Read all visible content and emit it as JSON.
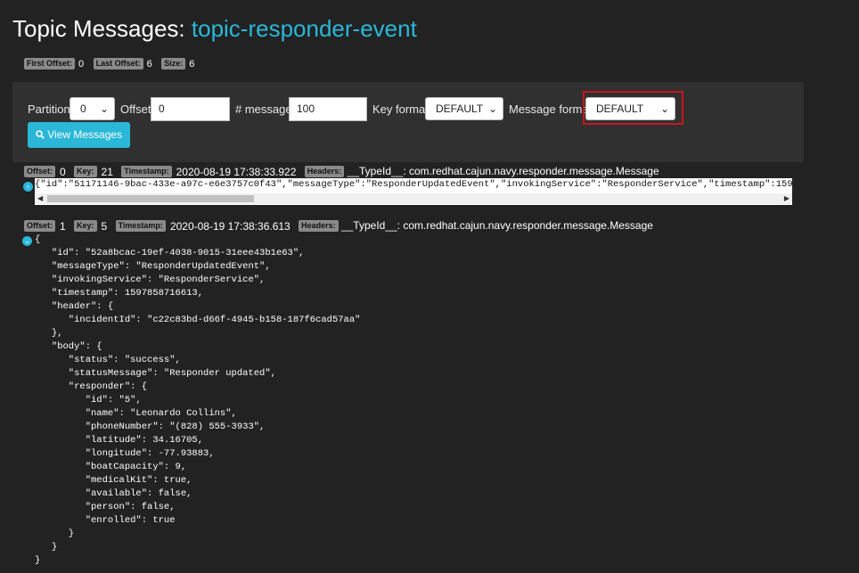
{
  "page": {
    "title_prefix": "Topic Messages:",
    "topic_name": "topic-responder-event",
    "accent_color": "#2ab7d8",
    "highlight_color": "#c8161d"
  },
  "meta": {
    "first_offset_label": "First Offset:",
    "first_offset": "0",
    "last_offset_label": "Last Offset:",
    "last_offset": "6",
    "size_label": "Size:",
    "size": "6"
  },
  "form": {
    "partition_label": "Partition",
    "partition_value": "0",
    "offset_label": "Offset",
    "offset_value": "0",
    "messages_label": "# messages",
    "messages_value": "100",
    "key_format_label": "Key format",
    "key_format_value": "DEFAULT",
    "message_format_label": "Message format",
    "message_format_value": "DEFAULT",
    "view_button": "View Messages",
    "search_icon": "search-icon"
  },
  "messages": [
    {
      "offset_label": "Offset:",
      "offset": "0",
      "key_label": "Key:",
      "key": "21",
      "timestamp_label": "Timestamp:",
      "timestamp": "2020-08-19 17:38:33.922",
      "headers_label": "Headers:",
      "headers": "__TypeId__: com.redhat.cajun.navy.responder.message.Message",
      "collapsed_preview": "{\"id\":\"51171146-9bac-433e-a97c-e6e3757c0f43\",\"messageType\":\"ResponderUpdatedEvent\",\"invokingService\":\"ResponderService\",\"timestamp\":159"
    },
    {
      "offset_label": "Offset:",
      "offset": "1",
      "key_label": "Key:",
      "key": "5",
      "timestamp_label": "Timestamp:",
      "timestamp": "2020-08-19 17:38:36.613",
      "headers_label": "Headers:",
      "headers": "__TypeId__: com.redhat.cajun.navy.responder.message.Message",
      "expanded_json": "{\n   \"id\": \"52a8bcac-19ef-4038-9015-31eee43b1e63\",\n   \"messageType\": \"ResponderUpdatedEvent\",\n   \"invokingService\": \"ResponderService\",\n   \"timestamp\": 1597858716613,\n   \"header\": {\n      \"incidentId\": \"c22c83bd-d66f-4945-b158-187f6cad57aa\"\n   },\n   \"body\": {\n      \"status\": \"success\",\n      \"statusMessage\": \"Responder updated\",\n      \"responder\": {\n         \"id\": \"5\",\n         \"name\": \"Leonardo Collins\",\n         \"phoneNumber\": \"(828) 555-3933\",\n         \"latitude\": 34.16705,\n         \"longitude\": -77.93883,\n         \"boatCapacity\": 9,\n         \"medicalKit\": true,\n         \"available\": false,\n         \"person\": false,\n         \"enrolled\": true\n      }\n   }\n}"
    }
  ]
}
